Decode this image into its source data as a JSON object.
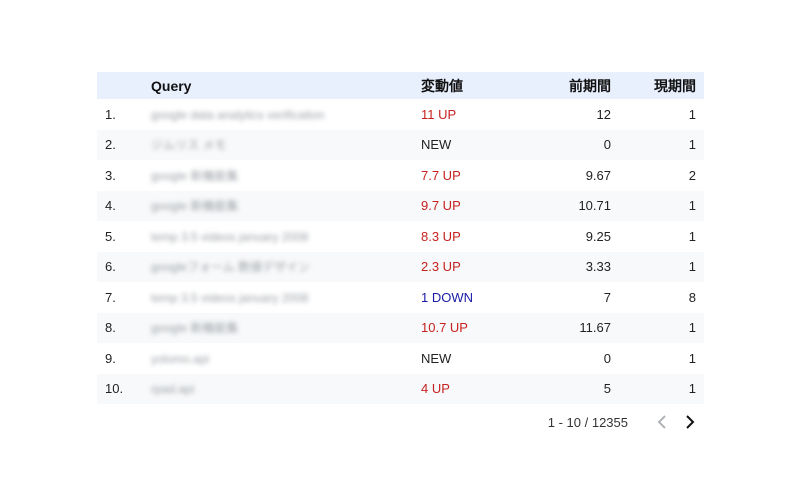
{
  "table": {
    "headers": {
      "num": "",
      "query": "Query",
      "change": "変動値",
      "prev": "前期間",
      "current": "現期間"
    },
    "rows": [
      {
        "num": "1.",
        "query": "google data analytics verification",
        "change": "11 UP",
        "change_type": "up",
        "prev": "12",
        "current": "1"
      },
      {
        "num": "2.",
        "query": "ジムリス メモ",
        "change": "NEW",
        "change_type": "neutral",
        "prev": "0",
        "current": "1"
      },
      {
        "num": "3.",
        "query": "google 新機能集",
        "change": "7.7 UP",
        "change_type": "up",
        "prev": "9.67",
        "current": "2"
      },
      {
        "num": "4.",
        "query": "google 新機能集",
        "change": "9.7 UP",
        "change_type": "up",
        "prev": "10.71",
        "current": "1"
      },
      {
        "num": "5.",
        "query": "temp 3.5 videos january 2008",
        "change": "8.3 UP",
        "change_type": "up",
        "prev": "9.25",
        "current": "1"
      },
      {
        "num": "6.",
        "query": "googleフォーム 数値デザイン",
        "change": "2.3 UP",
        "change_type": "up",
        "prev": "3.33",
        "current": "1"
      },
      {
        "num": "7.",
        "query": "temp 3.5 videos january 2008",
        "change": "1 DOWN",
        "change_type": "down",
        "prev": "7",
        "current": "8"
      },
      {
        "num": "8.",
        "query": "google 新機能集",
        "change": "10.7 UP",
        "change_type": "up",
        "prev": "11.67",
        "current": "1"
      },
      {
        "num": "9.",
        "query": "yolomo.api",
        "change": "NEW",
        "change_type": "neutral",
        "prev": "0",
        "current": "1"
      },
      {
        "num": "10.",
        "query": "rpad.api",
        "change": "4 UP",
        "change_type": "up",
        "prev": "5",
        "current": "1"
      }
    ]
  },
  "pagination": {
    "info": "1 - 10 / 12355",
    "prev_icon": "chevron-left-icon",
    "next_icon": "chevron-right-icon"
  },
  "colors": {
    "header_bg": "#e8f0fe",
    "up": "#c5221f",
    "down": "#1a1aa8",
    "stripe": "#f8f9fa"
  }
}
